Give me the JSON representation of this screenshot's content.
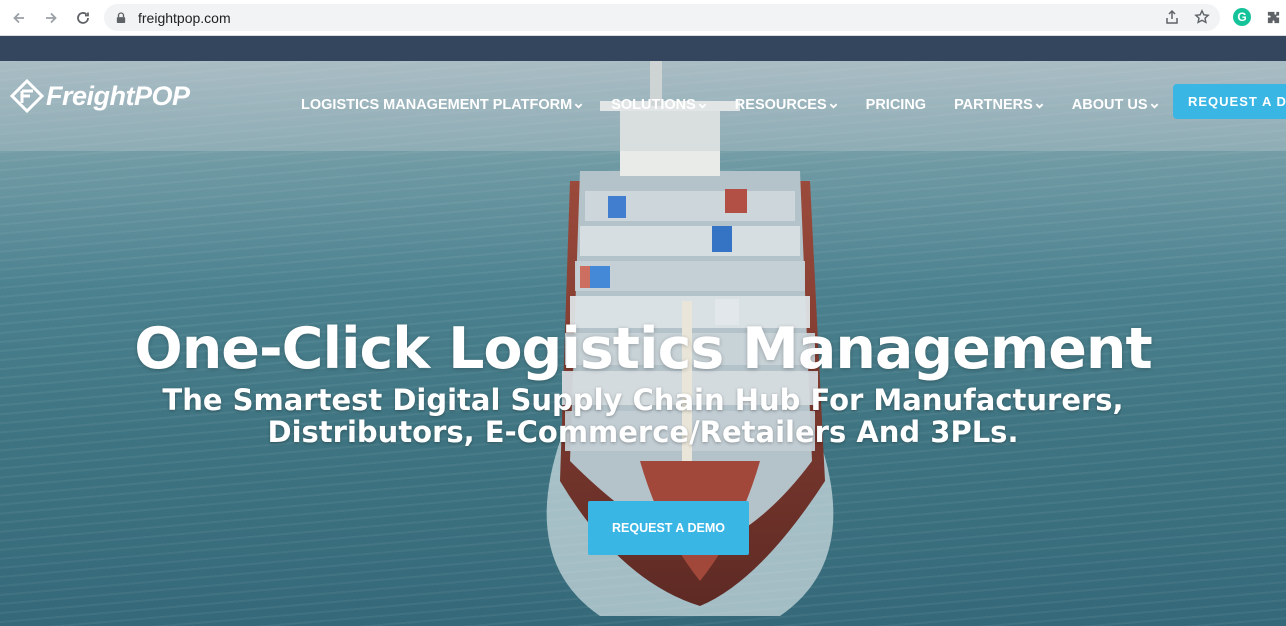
{
  "browser": {
    "url": "freightpop.com",
    "extension_grammarly": "G"
  },
  "header": {
    "logo_text": "FreightPOP",
    "nav": [
      {
        "label": "LOGISTICS MANAGEMENT PLATFORM",
        "has_dropdown": true
      },
      {
        "label": "SOLUTIONS",
        "has_dropdown": true
      },
      {
        "label": "RESOURCES",
        "has_dropdown": true
      },
      {
        "label": "PRICING",
        "has_dropdown": false
      },
      {
        "label": "PARTNERS",
        "has_dropdown": true
      },
      {
        "label": "ABOUT US",
        "has_dropdown": true
      }
    ],
    "cta_label": "REQUEST A DE"
  },
  "hero": {
    "title": "One-Click Logistics Management",
    "subtitle_line1": "The Smartest Digital Supply Chain Hub For Manufacturers,",
    "subtitle_line2": "Distributors, E-Commerce/Retailers And 3PLs.",
    "cta_label": "REQUEST A DEMO"
  },
  "colors": {
    "accent": "#3ab6e5",
    "top_strip": "#34465e",
    "grammarly": "#15c39a"
  }
}
